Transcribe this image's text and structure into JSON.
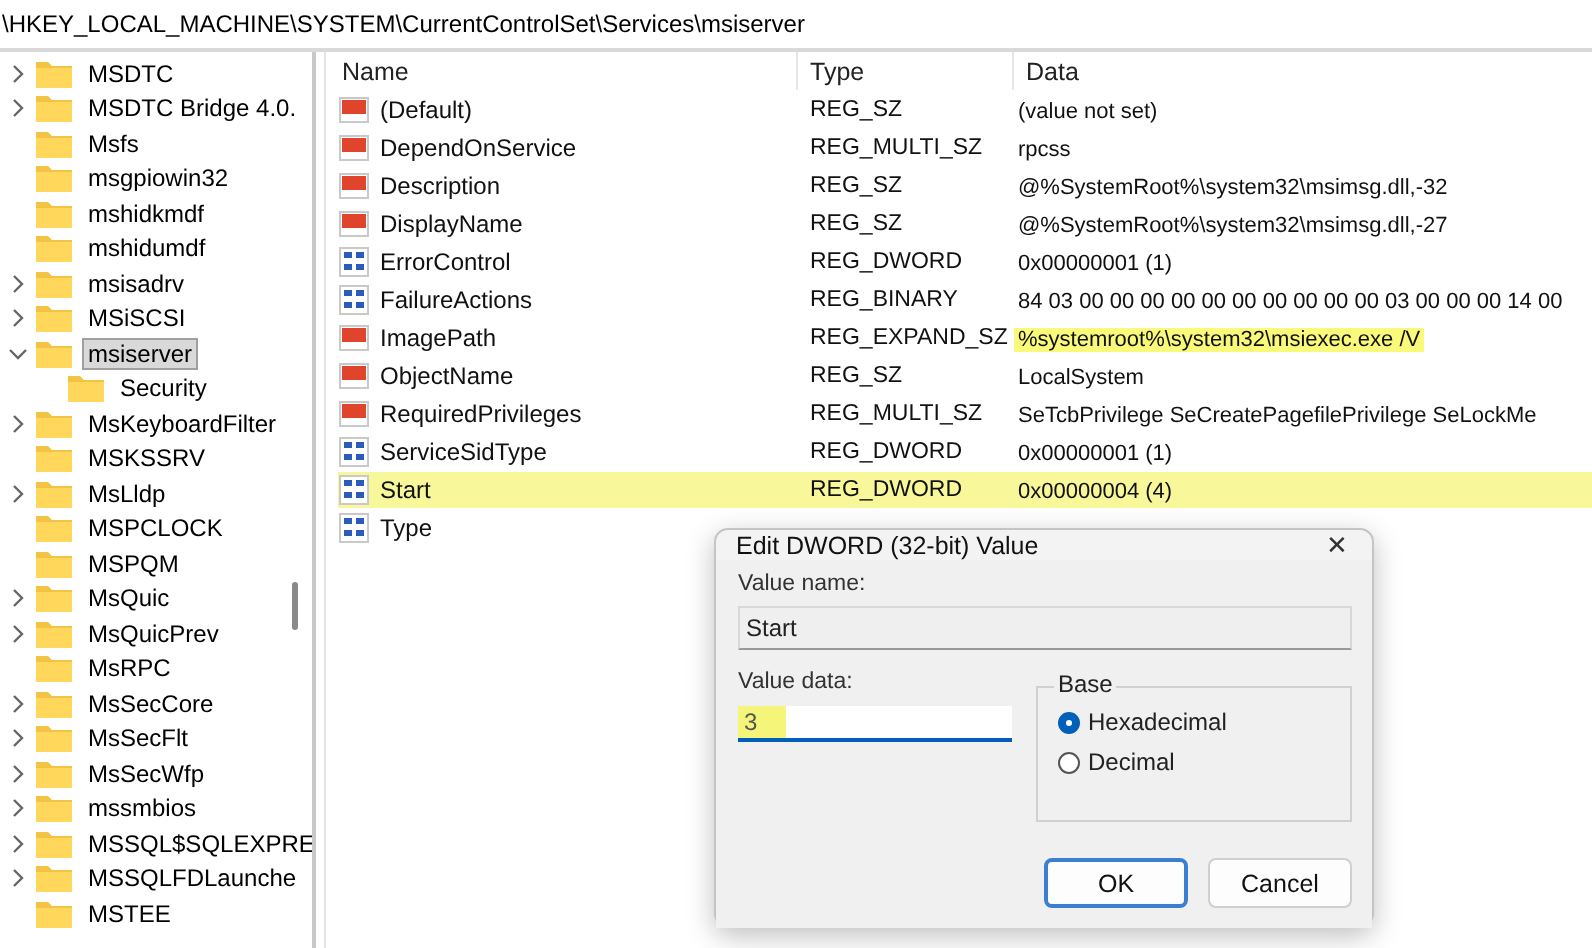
{
  "address_bar": {
    "path": "\\HKEY_LOCAL_MACHINE\\SYSTEM\\CurrentControlSet\\Services\\msiserver"
  },
  "tree": {
    "items": [
      {
        "label": "MSDTC",
        "expandable": true,
        "selected": false
      },
      {
        "label": "MSDTC Bridge 4.0.",
        "expandable": true,
        "selected": false
      },
      {
        "label": "Msfs",
        "expandable": false,
        "selected": false
      },
      {
        "label": "msgpiowin32",
        "expandable": false,
        "selected": false
      },
      {
        "label": "mshidkmdf",
        "expandable": false,
        "selected": false
      },
      {
        "label": "mshidumdf",
        "expandable": false,
        "selected": false
      },
      {
        "label": "msisadrv",
        "expandable": true,
        "selected": false
      },
      {
        "label": "MSiSCSI",
        "expandable": true,
        "selected": false
      },
      {
        "label": "msiserver",
        "expandable": true,
        "expanded": true,
        "selected": true,
        "children": [
          {
            "label": "Security",
            "expandable": false,
            "selected": false
          }
        ]
      },
      {
        "label": "MsKeyboardFilter",
        "expandable": true,
        "selected": false
      },
      {
        "label": "MSKSSRV",
        "expandable": false,
        "selected": false
      },
      {
        "label": "MsLldp",
        "expandable": true,
        "selected": false
      },
      {
        "label": "MSPCLOCK",
        "expandable": false,
        "selected": false
      },
      {
        "label": "MSPQM",
        "expandable": false,
        "selected": false
      },
      {
        "label": "MsQuic",
        "expandable": true,
        "selected": false
      },
      {
        "label": "MsQuicPrev",
        "expandable": true,
        "selected": false
      },
      {
        "label": "MsRPC",
        "expandable": false,
        "selected": false
      },
      {
        "label": "MsSecCore",
        "expandable": true,
        "selected": false
      },
      {
        "label": "MsSecFlt",
        "expandable": true,
        "selected": false
      },
      {
        "label": "MsSecWfp",
        "expandable": true,
        "selected": false
      },
      {
        "label": "mssmbios",
        "expandable": true,
        "selected": false
      },
      {
        "label": "MSSQL$SQLEXPRE",
        "expandable": true,
        "selected": false
      },
      {
        "label": "MSSQLFDLaunche",
        "expandable": true,
        "selected": false
      },
      {
        "label": "MSTEE",
        "expandable": false,
        "selected": false
      }
    ]
  },
  "table": {
    "columns": [
      "Name",
      "Type",
      "Data"
    ],
    "rows": [
      {
        "kind": "string",
        "name": "(Default)",
        "type": "REG_SZ",
        "data": "(value not set)"
      },
      {
        "kind": "string",
        "name": "DependOnService",
        "type": "REG_MULTI_SZ",
        "data": "rpcss"
      },
      {
        "kind": "string",
        "name": "Description",
        "type": "REG_SZ",
        "data": "@%SystemRoot%\\system32\\msimsg.dll,-32"
      },
      {
        "kind": "string",
        "name": "DisplayName",
        "type": "REG_SZ",
        "data": "@%SystemRoot%\\system32\\msimsg.dll,-27"
      },
      {
        "kind": "binary",
        "name": "ErrorControl",
        "type": "REG_DWORD",
        "data": "0x00000001 (1)"
      },
      {
        "kind": "binary",
        "name": "FailureActions",
        "type": "REG_BINARY",
        "data": "84 03 00 00 00 00 00 00 00 00 00 00 03 00 00 00 14 00"
      },
      {
        "kind": "string",
        "name": "ImagePath",
        "type": "REG_EXPAND_SZ",
        "data": "%systemroot%\\system32\\msiexec.exe /V",
        "data_highlighted": true
      },
      {
        "kind": "string",
        "name": "ObjectName",
        "type": "REG_SZ",
        "data": "LocalSystem"
      },
      {
        "kind": "string",
        "name": "RequiredPrivileges",
        "type": "REG_MULTI_SZ",
        "data": "SeTcbPrivilege SeCreatePagefilePrivilege SeLockMe"
      },
      {
        "kind": "binary",
        "name": "ServiceSidType",
        "type": "REG_DWORD",
        "data": "0x00000001 (1)"
      },
      {
        "kind": "binary",
        "name": "Start",
        "type": "REG_DWORD",
        "data": "0x00000004 (4)",
        "row_highlighted": true
      },
      {
        "kind": "binary",
        "name": "Type"
      }
    ]
  },
  "dialog": {
    "title": "Edit DWORD (32-bit) Value",
    "close": "✕",
    "value_name_label": "Value name:",
    "value_name": "Start",
    "value_data_label": "Value data:",
    "value_data": "3",
    "value_data_highlighted": true,
    "base": {
      "label": "Base",
      "options": [
        {
          "label": "Hexadecimal",
          "selected": true
        },
        {
          "label": "Decimal",
          "selected": false
        }
      ]
    },
    "buttons": [
      {
        "label": "OK",
        "default": true
      },
      {
        "label": "Cancel",
        "default": false
      }
    ]
  }
}
